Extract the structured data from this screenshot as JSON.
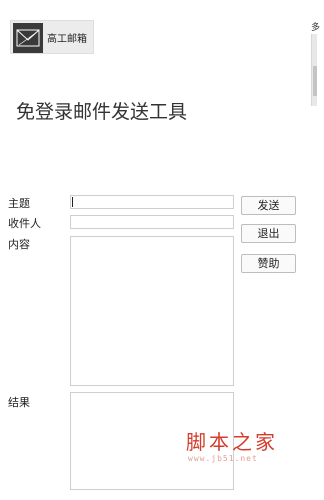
{
  "header": {
    "logo_text": "高工邮箱",
    "title": "免登录邮件发送工具"
  },
  "form": {
    "subject_label": "主题",
    "subject_value": "",
    "recipient_label": "收件人",
    "recipient_value": "",
    "content_label": "内容",
    "content_value": "",
    "result_label": "结果",
    "result_value": ""
  },
  "buttons": {
    "send": "发送",
    "exit": "退出",
    "donate": "赞助"
  },
  "side": {
    "char": "多"
  },
  "watermark": {
    "big": "脚本之家",
    "small": "www.jb51.net"
  },
  "icons": {
    "logo": "envelope-paper-plane-icon"
  },
  "colors": {
    "watermark_red": "#d43c2c",
    "logo_bg": "#3a3a3a"
  }
}
